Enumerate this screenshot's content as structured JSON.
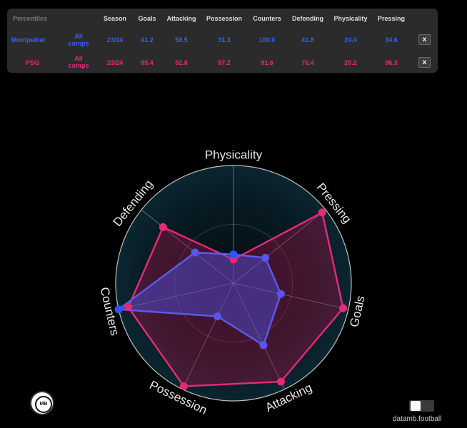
{
  "colors": {
    "panel_bg": "#2b2b2b",
    "montpellier": "#3b5bff",
    "psg": "#e8287a",
    "header": "#dddddd"
  },
  "table": {
    "title": "Percentiles",
    "columns": [
      "Season",
      "Goals",
      "Attacking",
      "Possession",
      "Counters",
      "Defending",
      "Physicality",
      "Pressing"
    ],
    "rows": [
      {
        "team": "Montpellier",
        "comps_line1": "All",
        "comps_line2": "comps",
        "values": [
          "23/24",
          "41.2",
          "58.5",
          "31.3",
          "100.0",
          "41.8",
          "24.4",
          "34.6"
        ],
        "remove_label": "x"
      },
      {
        "team": "PSG",
        "comps_line1": "All",
        "comps_line2": "comps",
        "values": [
          "23/24",
          "95.4",
          "92.8",
          "97.2",
          "91.6",
          "76.4",
          "20.2",
          "96.3"
        ],
        "remove_label": "x"
      }
    ]
  },
  "chart_data": {
    "type": "radar",
    "axes": [
      "Physicality",
      "Pressing",
      "Goals",
      "Attacking",
      "Possession",
      "Counters",
      "Defending"
    ],
    "range": [
      0,
      100
    ],
    "series": [
      {
        "name": "Montpellier",
        "color": "#3b5bff",
        "values": [
          24.4,
          34.6,
          41.2,
          58.5,
          31.3,
          100.0,
          41.8
        ]
      },
      {
        "name": "PSG",
        "color": "#e8287a",
        "values": [
          20.2,
          96.3,
          95.4,
          92.8,
          97.2,
          91.6,
          76.4
        ]
      }
    ]
  },
  "logo": {
    "text": "MB"
  },
  "watermark": "datamb.football"
}
